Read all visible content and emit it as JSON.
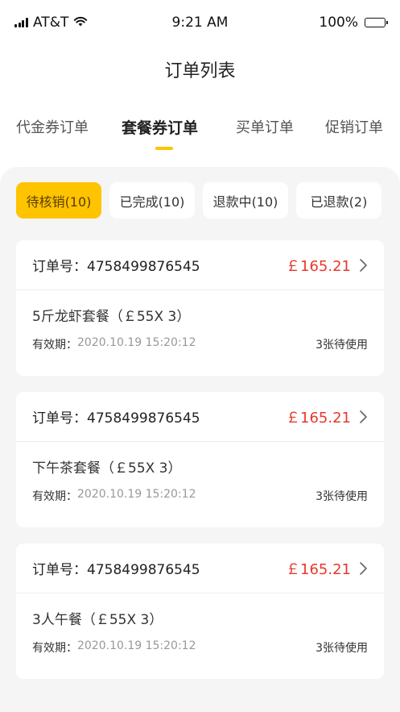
{
  "status_bar": {
    "carrier": "AT&T",
    "time": "9:21 AM",
    "battery": "100%"
  },
  "header": {
    "title": "订单列表"
  },
  "tabs": [
    {
      "label": "代金券订单",
      "active": false
    },
    {
      "label": "套餐券订单",
      "active": true
    },
    {
      "label": "买单订单",
      "active": false
    },
    {
      "label": "促销订单",
      "active": false
    }
  ],
  "filters": [
    {
      "label": "待核销(10)",
      "active": true
    },
    {
      "label": "已完成(10)",
      "active": false
    },
    {
      "label": "退款中(10)",
      "active": false
    },
    {
      "label": "已退款(2)",
      "active": false
    }
  ],
  "orders": [
    {
      "order_no": "订单号：4758499876545",
      "amount": "￡165.21",
      "item": "5斤龙虾套餐（￡55X 3）",
      "validity_label": "有效期：",
      "validity_date": "2020.10.19 15:20:12",
      "count": "3张待使用"
    },
    {
      "order_no": "订单号：4758499876545",
      "amount": "￡165.21",
      "item": "下午茶套餐（￡55X 3）",
      "validity_label": "有效期：",
      "validity_date": "2020.10.19 15:20:12",
      "count": "3张待使用"
    },
    {
      "order_no": "订单号：4758499876545",
      "amount": "￡165.21",
      "item": "3人午餐（￡55X 3）",
      "validity_label": "有效期：",
      "validity_date": "2020.10.19 15:20:12",
      "count": "3张待使用"
    }
  ],
  "colors": {
    "accent": "#FFC300",
    "price": "#E8382B",
    "background": "#F5F5F5"
  },
  "icons": [
    "signal-icon",
    "wifi-icon",
    "battery-icon",
    "chevron-right-icon"
  ]
}
